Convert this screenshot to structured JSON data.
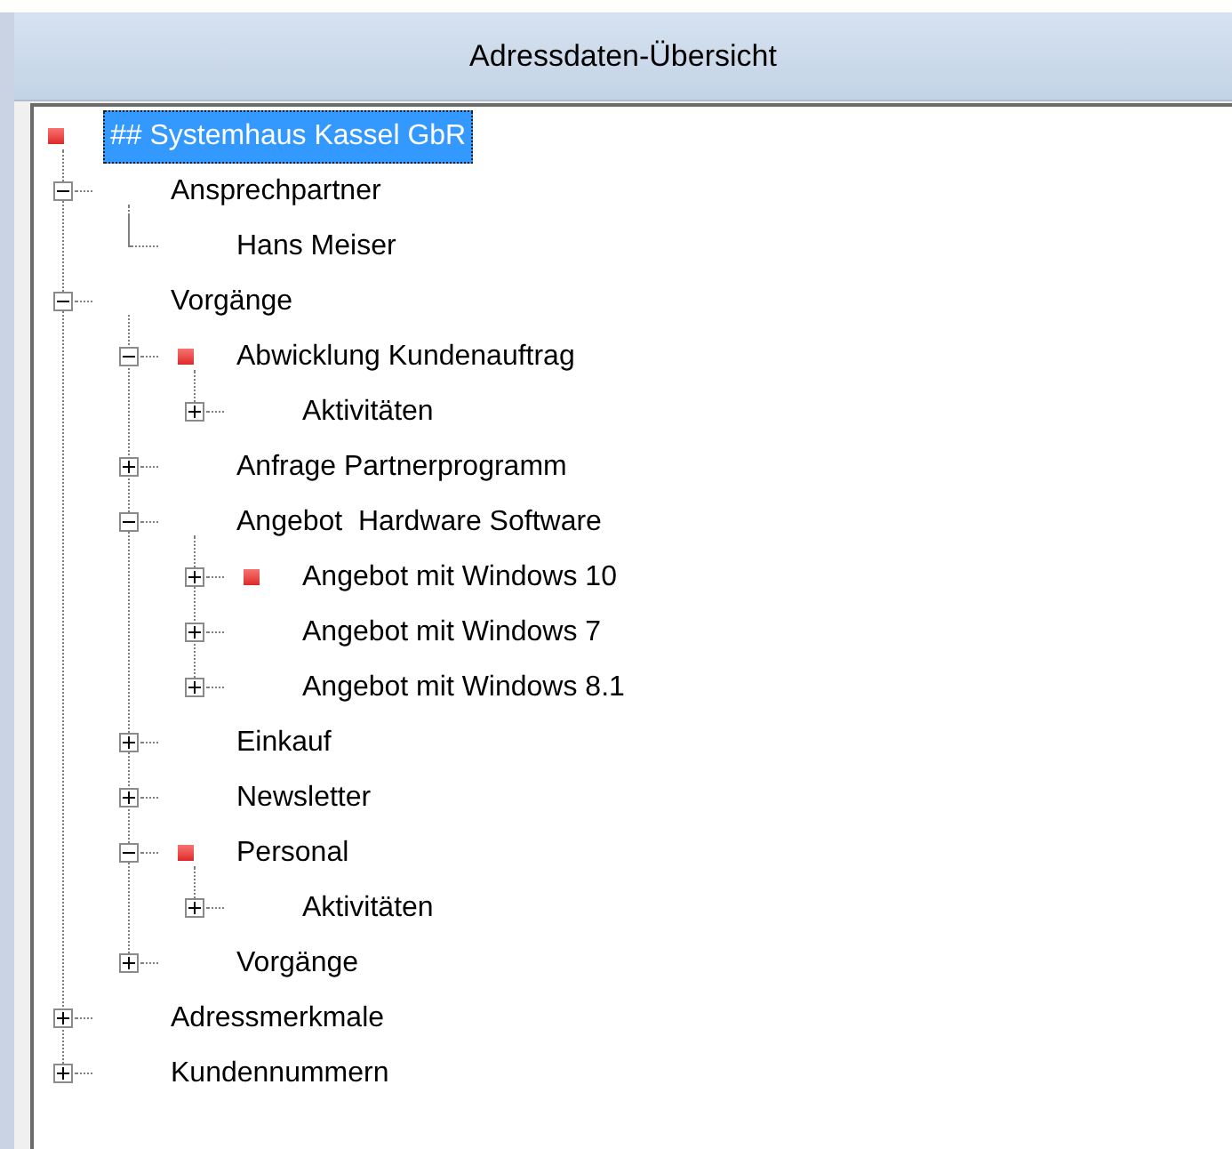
{
  "header": {
    "title": "Adressdaten-Übersicht"
  },
  "tree": {
    "label": "## Systemhaus Kassel GbR",
    "selected": true,
    "marked": true,
    "children": [
      {
        "label": "Ansprechpartner",
        "expanded": true,
        "marked": false,
        "children": [
          {
            "label": "Hans Meiser",
            "marked": false
          }
        ]
      },
      {
        "label": "Vorgänge",
        "expanded": true,
        "marked": false,
        "children": [
          {
            "label": "Abwicklung Kundenauftrag",
            "expanded": true,
            "marked": true,
            "children": [
              {
                "label": "Aktivitäten",
                "expanded": false,
                "marked": false
              }
            ]
          },
          {
            "label": "Anfrage Partnerprogramm",
            "expanded": false,
            "marked": false
          },
          {
            "label": "Angebot  Hardware Software",
            "expanded": true,
            "marked": false,
            "children": [
              {
                "label": "Angebot mit Windows 10",
                "expanded": false,
                "marked": true
              },
              {
                "label": "Angebot mit Windows 7",
                "expanded": false,
                "marked": false
              },
              {
                "label": "Angebot mit Windows 8.1",
                "expanded": false,
                "marked": false
              }
            ]
          },
          {
            "label": "Einkauf",
            "expanded": false,
            "marked": false
          },
          {
            "label": "Newsletter",
            "expanded": false,
            "marked": false
          },
          {
            "label": "Personal",
            "expanded": true,
            "marked": true,
            "children": [
              {
                "label": "Aktivitäten",
                "expanded": false,
                "marked": false
              }
            ]
          },
          {
            "label": "Vorgänge",
            "expanded": false,
            "marked": false
          }
        ]
      },
      {
        "label": "Adressmerkmale",
        "expanded": false,
        "marked": false
      },
      {
        "label": "Kundennummern",
        "expanded": false,
        "marked": false
      }
    ]
  }
}
